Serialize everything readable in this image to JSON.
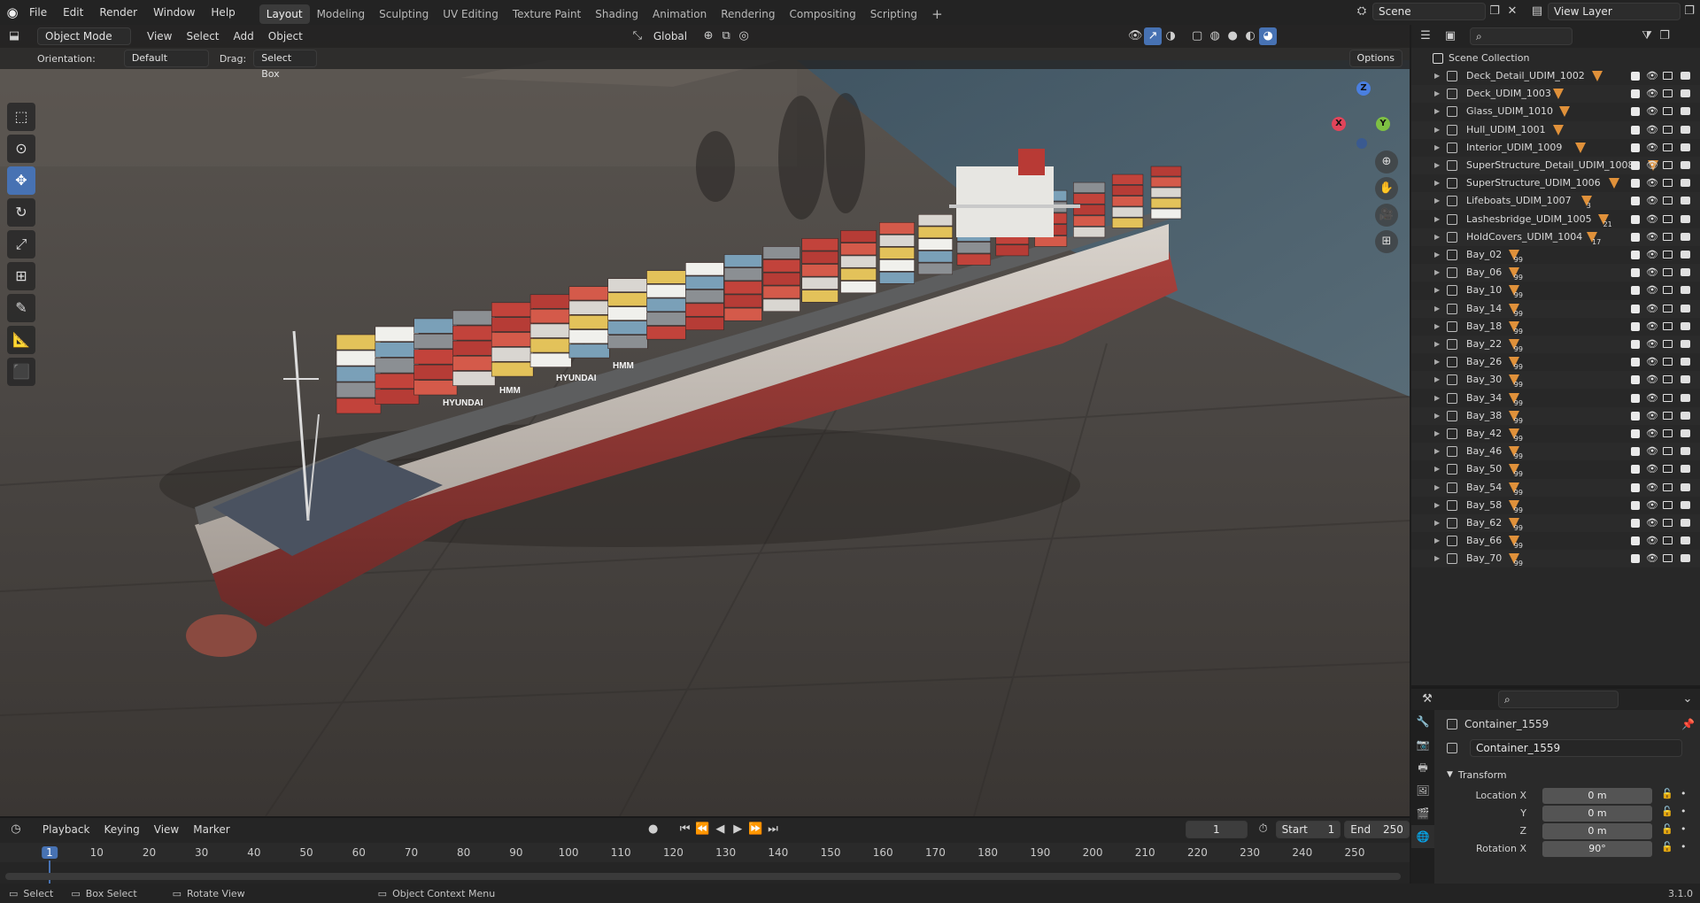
{
  "topbar": {
    "menus": [
      "File",
      "Edit",
      "Render",
      "Window",
      "Help"
    ],
    "workspaces": [
      "Layout",
      "Modeling",
      "Sculpting",
      "UV Editing",
      "Texture Paint",
      "Shading",
      "Animation",
      "Rendering",
      "Compositing",
      "Scripting"
    ],
    "active_workspace": "Layout",
    "add_workspace": "+",
    "scene_name": "Scene",
    "view_layer": "View Layer"
  },
  "viewport_header": {
    "mode": "Object Mode",
    "menus": [
      "View",
      "Select",
      "Add",
      "Object"
    ],
    "transform_orientation": "Global"
  },
  "tool_settings": {
    "orientation_label": "Orientation:",
    "orientation_value": "Default",
    "drag_label": "Drag:",
    "drag_value": "Select Box",
    "options_label": "Options"
  },
  "gizmo": {
    "x": "X",
    "y": "Y",
    "z": "Z"
  },
  "scene": {
    "container_brands": [
      "HYUNDAI",
      "HMM"
    ]
  },
  "outliner": {
    "root": "Scene Collection",
    "items": [
      {
        "name": "Deck_Detail_UDIM_1002",
        "count": ""
      },
      {
        "name": "Deck_UDIM_1003",
        "count": ""
      },
      {
        "name": "Glass_UDIM_1010",
        "count": ""
      },
      {
        "name": "Hull_UDIM_1001",
        "count": ""
      },
      {
        "name": "Interior_UDIM_1009",
        "count": ""
      },
      {
        "name": "SuperStructure_Detail_UDIM_1008",
        "count": ""
      },
      {
        "name": "SuperStructure_UDIM_1006",
        "count": ""
      },
      {
        "name": "Lifeboats_UDIM_1007",
        "count": "3"
      },
      {
        "name": "Lashesbridge_UDIM_1005",
        "count": "21"
      },
      {
        "name": "HoldCovers_UDIM_1004",
        "count": "17"
      },
      {
        "name": "Bay_02",
        "count": "99"
      },
      {
        "name": "Bay_06",
        "count": "99"
      },
      {
        "name": "Bay_10",
        "count": "99"
      },
      {
        "name": "Bay_14",
        "count": "99"
      },
      {
        "name": "Bay_18",
        "count": "99"
      },
      {
        "name": "Bay_22",
        "count": "99"
      },
      {
        "name": "Bay_26",
        "count": "99"
      },
      {
        "name": "Bay_30",
        "count": "99"
      },
      {
        "name": "Bay_34",
        "count": "99"
      },
      {
        "name": "Bay_38",
        "count": "99"
      },
      {
        "name": "Bay_42",
        "count": "99"
      },
      {
        "name": "Bay_46",
        "count": "99"
      },
      {
        "name": "Bay_50",
        "count": "99"
      },
      {
        "name": "Bay_54",
        "count": "99"
      },
      {
        "name": "Bay_58",
        "count": "99"
      },
      {
        "name": "Bay_62",
        "count": "99"
      },
      {
        "name": "Bay_66",
        "count": "99"
      },
      {
        "name": "Bay_70",
        "count": "99"
      }
    ]
  },
  "properties": {
    "object_name": "Container_1559",
    "data_name": "Container_1559",
    "panel": "Transform",
    "fields": [
      {
        "label": "Location X",
        "value": "0 m"
      },
      {
        "label": "Y",
        "value": "0 m"
      },
      {
        "label": "Z",
        "value": "0 m"
      },
      {
        "label": "Rotation X",
        "value": "90°"
      }
    ]
  },
  "timeline": {
    "menus": [
      "Playback",
      "Keying",
      "View",
      "Marker"
    ],
    "current_frame": "1",
    "start_label": "Start",
    "start_value": "1",
    "end_label": "End",
    "end_value": "250",
    "ticks": [
      "1",
      "10",
      "20",
      "30",
      "40",
      "50",
      "60",
      "70",
      "80",
      "90",
      "100",
      "110",
      "120",
      "130",
      "140",
      "150",
      "160",
      "170",
      "180",
      "190",
      "200",
      "210",
      "220",
      "230",
      "240",
      "250"
    ]
  },
  "statusbar": {
    "select": "Select",
    "box_select": "Box Select",
    "rotate_view": "Rotate View",
    "context_menu": "Object Context Menu",
    "version": "3.1.0"
  }
}
